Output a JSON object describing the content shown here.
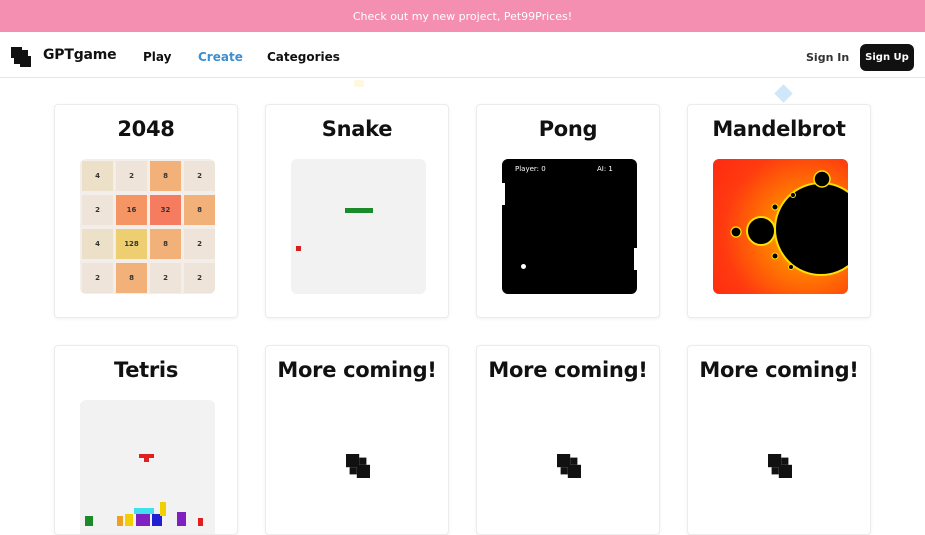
{
  "banner": {
    "text": "Check out my new project, Pet99Prices!"
  },
  "nav": {
    "brand": "GPTgame",
    "links": {
      "play": "Play",
      "create": "Create",
      "categories": "Categories"
    },
    "sign_in": "Sign In",
    "sign_up": "Sign Up",
    "active_color": "#3d8fd1"
  },
  "cards": {
    "g2048": {
      "title": "2048",
      "tiles": [
        "4",
        "2",
        "8",
        "2",
        "2",
        "16",
        "32",
        "8",
        "4",
        "128",
        "8",
        "2",
        "2",
        "8",
        "2",
        "2"
      ]
    },
    "snake": {
      "title": "Snake"
    },
    "pong": {
      "title": "Pong",
      "player_score": "Player: 0",
      "ai_score": "AI: 1"
    },
    "mandelbrot": {
      "title": "Mandelbrot"
    },
    "tetris": {
      "title": "Tetris"
    },
    "more1": {
      "title": "More coming!"
    },
    "more2": {
      "title": "More coming!"
    },
    "more3": {
      "title": "More coming!"
    }
  },
  "colors": {
    "banner": "#f48fb1",
    "snake_body": "#1a8a2a",
    "snake_food": "#d62020"
  }
}
